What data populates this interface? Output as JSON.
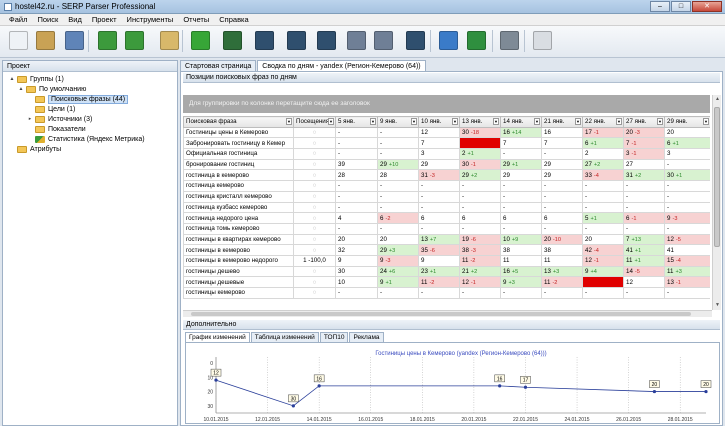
{
  "window": {
    "title": "hostel42.ru - SERP Parser Professional"
  },
  "menu": [
    "Файл",
    "Поиск",
    "Вид",
    "Проект",
    "Инструменты",
    "Отчеты",
    "Справка"
  ],
  "toolbar": {
    "buttons": [
      {
        "name": "new-project-icon",
        "color": "#eef2f6"
      },
      {
        "name": "open-folder-icon",
        "color": "#c9a255"
      },
      {
        "name": "settings-gear-icon",
        "color": "#5f84b8"
      },
      {
        "name": "play-icon",
        "color": "#3c9a3c"
      },
      {
        "name": "play-next-icon",
        "color": "#3c9a3c"
      },
      {
        "name": "edit-list-icon",
        "color": "#d8b86a"
      },
      {
        "name": "add-icon",
        "color": "#37a637"
      },
      {
        "name": "chart-icon",
        "color": "#2f6e3a"
      },
      {
        "name": "chart-line-icon",
        "color": "#2f4f6e"
      },
      {
        "name": "chart-up-icon",
        "color": "#2f4f6e"
      },
      {
        "name": "chart-circle-icon",
        "color": "#2f4f6e"
      },
      {
        "name": "calendar-chart-icon",
        "color": "#6f7f96"
      },
      {
        "name": "calendar-check-icon",
        "color": "#6f7f96"
      },
      {
        "name": "chart-area-icon",
        "color": "#2f4f6e"
      },
      {
        "name": "refresh-icon",
        "color": "#3a7bc8"
      },
      {
        "name": "excel-icon",
        "color": "#2f8f3f"
      },
      {
        "name": "sliders-icon",
        "color": "#7e8a96"
      },
      {
        "name": "home-icon",
        "color": "#d9dde2"
      }
    ]
  },
  "project_panel": {
    "header": "Проект",
    "tree": [
      {
        "label": "Группы (1)",
        "level": 0,
        "expander": "▲",
        "icon": "folder"
      },
      {
        "label": "По умолчанию",
        "level": 1,
        "expander": "▲",
        "icon": "folder"
      },
      {
        "label": "Поисковые фразы (44)",
        "level": 2,
        "expander": "",
        "icon": "folder",
        "selected": true
      },
      {
        "label": "Цели (1)",
        "level": 2,
        "expander": "",
        "icon": "folder"
      },
      {
        "label": "Источники (3)",
        "level": 2,
        "expander": "▸",
        "icon": "folder"
      },
      {
        "label": "Показатели",
        "level": 2,
        "expander": "",
        "icon": "folder"
      },
      {
        "label": "Статистика (Яндекс Метрика)",
        "level": 2,
        "expander": "",
        "icon": "stats"
      },
      {
        "label": "Атрибуты",
        "level": 0,
        "expander": "",
        "icon": "folder"
      }
    ]
  },
  "doc_tabs": [
    {
      "label": "Стартовая страница",
      "active": false
    },
    {
      "label": "Сводка по дням - yandex (Регион-Кемерово (64))",
      "active": true
    }
  ],
  "positions_section": {
    "header": "Позиции поисковых фраз по дням",
    "group_hint": "Для группировки по колонке перетащите сюда ее заголовок"
  },
  "grid": {
    "columns": [
      "Поисковая фраза",
      "Посещения",
      "5 янв.",
      "9 янв.",
      "10 янв.",
      "13 янв.",
      "14 янв.",
      "21 янв.",
      "22 янв.",
      "27 янв.",
      "29 янв."
    ],
    "rows": [
      {
        "phrase": "Гостиницы цены в Кемерово",
        "visits": "○",
        "cells": [
          [
            "-",
            ""
          ],
          [
            "-",
            ""
          ],
          [
            "12",
            ""
          ],
          [
            "30",
            "-18",
            "neg"
          ],
          [
            "16",
            "+14",
            "pos"
          ],
          [
            "16",
            ""
          ],
          [
            "17",
            "-1",
            "neg"
          ],
          [
            "20",
            "-3",
            "neg"
          ],
          [
            "20",
            ""
          ]
        ]
      },
      {
        "phrase": "Забронировать гостиницу в Кемер",
        "visits": "○",
        "cells": [
          [
            "-",
            ""
          ],
          [
            "-",
            ""
          ],
          [
            "7",
            ""
          ],
          [
            "",
            "",
            "hot"
          ],
          [
            "7",
            ""
          ],
          [
            "7",
            ""
          ],
          [
            "6",
            "+1",
            "pos"
          ],
          [
            "7",
            "-1",
            "neg"
          ],
          [
            "6",
            "+1",
            "pos"
          ]
        ]
      },
      {
        "phrase": "Официальная гостиница",
        "visits": "○",
        "cells": [
          [
            "-",
            ""
          ],
          [
            "-",
            ""
          ],
          [
            "3",
            ""
          ],
          [
            "2",
            "+1",
            "pos"
          ],
          [
            "-",
            ""
          ],
          [
            "-",
            ""
          ],
          [
            "2",
            ""
          ],
          [
            "3",
            "-1",
            "neg"
          ],
          [
            "3",
            ""
          ]
        ]
      },
      {
        "phrase": "бронирование гостиниц",
        "visits": "○",
        "cells": [
          [
            "39",
            ""
          ],
          [
            "29",
            "+10",
            "pos"
          ],
          [
            "29",
            ""
          ],
          [
            "30",
            "-1",
            "neg"
          ],
          [
            "29",
            "+1",
            "pos"
          ],
          [
            "29",
            ""
          ],
          [
            "27",
            "+2",
            "pos"
          ],
          [
            "27",
            ""
          ],
          [
            "-",
            ""
          ]
        ]
      },
      {
        "phrase": "гостиница в кемерово",
        "visits": "○",
        "cells": [
          [
            "28",
            ""
          ],
          [
            "28",
            ""
          ],
          [
            "31",
            "-3",
            "neg"
          ],
          [
            "29",
            "+2",
            "pos"
          ],
          [
            "29",
            ""
          ],
          [
            "29",
            ""
          ],
          [
            "33",
            "-4",
            "neg"
          ],
          [
            "31",
            "+2",
            "pos"
          ],
          [
            "30",
            "+1",
            "pos"
          ]
        ]
      },
      {
        "phrase": "гостиница кемерово",
        "visits": "○",
        "cells": [
          [
            "-",
            ""
          ],
          [
            "-",
            ""
          ],
          [
            "-",
            ""
          ],
          [
            "-",
            ""
          ],
          [
            "-",
            ""
          ],
          [
            "-",
            ""
          ],
          [
            "-",
            ""
          ],
          [
            "-",
            ""
          ],
          [
            "-",
            ""
          ]
        ]
      },
      {
        "phrase": "гостиница кристалл кемерово",
        "visits": "○",
        "cells": [
          [
            "-",
            ""
          ],
          [
            "-",
            ""
          ],
          [
            "-",
            ""
          ],
          [
            "-",
            ""
          ],
          [
            "-",
            ""
          ],
          [
            "-",
            ""
          ],
          [
            "-",
            ""
          ],
          [
            "-",
            ""
          ],
          [
            "-",
            ""
          ]
        ]
      },
      {
        "phrase": "гостиница кузбасс кемерово",
        "visits": "○",
        "cells": [
          [
            "-",
            ""
          ],
          [
            "-",
            ""
          ],
          [
            "-",
            ""
          ],
          [
            "-",
            ""
          ],
          [
            "-",
            ""
          ],
          [
            "-",
            ""
          ],
          [
            "-",
            ""
          ],
          [
            "-",
            ""
          ],
          [
            "-",
            ""
          ]
        ]
      },
      {
        "phrase": "гостиница недорого цена",
        "visits": "○",
        "cells": [
          [
            "4",
            ""
          ],
          [
            "6",
            "-2",
            "neg"
          ],
          [
            "6",
            ""
          ],
          [
            "6",
            ""
          ],
          [
            "6",
            ""
          ],
          [
            "6",
            ""
          ],
          [
            "5",
            "+1",
            "pos"
          ],
          [
            "6",
            "-1",
            "neg"
          ],
          [
            "9",
            "-3",
            "neg"
          ]
        ]
      },
      {
        "phrase": "гостиница томь кемерово",
        "visits": "○",
        "cells": [
          [
            "-",
            ""
          ],
          [
            "-",
            ""
          ],
          [
            "-",
            ""
          ],
          [
            "-",
            ""
          ],
          [
            "-",
            ""
          ],
          [
            "-",
            ""
          ],
          [
            "-",
            ""
          ],
          [
            "-",
            ""
          ],
          [
            "-",
            ""
          ]
        ]
      },
      {
        "phrase": "гостиницы в квартирах кемерово",
        "visits": "○",
        "cells": [
          [
            "20",
            ""
          ],
          [
            "20",
            ""
          ],
          [
            "13",
            "+7",
            "pos"
          ],
          [
            "19",
            "-6",
            "neg"
          ],
          [
            "10",
            "+9",
            "pos"
          ],
          [
            "20",
            "-10",
            "neg"
          ],
          [
            "20",
            ""
          ],
          [
            "7",
            "+13",
            "pos"
          ],
          [
            "12",
            "-5",
            "neg"
          ]
        ]
      },
      {
        "phrase": "гостиницы в кемерово",
        "visits": "○",
        "cells": [
          [
            "32",
            ""
          ],
          [
            "29",
            "+3",
            "pos"
          ],
          [
            "35",
            "-6",
            "neg"
          ],
          [
            "38",
            "-3",
            "neg"
          ],
          [
            "38",
            ""
          ],
          [
            "38",
            ""
          ],
          [
            "42",
            "-4",
            "neg"
          ],
          [
            "41",
            "+1",
            "pos"
          ],
          [
            "41",
            ""
          ]
        ]
      },
      {
        "phrase": "гостиницы в кемерово недорого",
        "visits": "1 -100,0",
        "cells": [
          [
            "9",
            ""
          ],
          [
            "9",
            "-3",
            "neg"
          ],
          [
            "9",
            ""
          ],
          [
            "11",
            "-2",
            "neg"
          ],
          [
            "11",
            ""
          ],
          [
            "11",
            ""
          ],
          [
            "12",
            "-1",
            "neg"
          ],
          [
            "11",
            "+1",
            "pos"
          ],
          [
            "15",
            "-4",
            "neg"
          ]
        ]
      },
      {
        "phrase": "гостиницы дешево",
        "visits": "○",
        "cells": [
          [
            "30",
            ""
          ],
          [
            "24",
            "+6",
            "pos"
          ],
          [
            "23",
            "+1",
            "pos"
          ],
          [
            "21",
            "+2",
            "pos"
          ],
          [
            "16",
            "+5",
            "pos"
          ],
          [
            "13",
            "+3",
            "pos"
          ],
          [
            "9",
            "+4",
            "pos"
          ],
          [
            "14",
            "-5",
            "neg"
          ],
          [
            "11",
            "+3",
            "pos"
          ]
        ]
      },
      {
        "phrase": "гостиницы дешевые",
        "visits": "○",
        "cells": [
          [
            "10",
            ""
          ],
          [
            "9",
            "+1",
            "pos"
          ],
          [
            "11",
            "-2",
            "neg"
          ],
          [
            "12",
            "-1",
            "neg"
          ],
          [
            "9",
            "+3",
            "pos"
          ],
          [
            "11",
            "-2",
            "neg"
          ],
          [
            "",
            "",
            "hot"
          ],
          [
            "12",
            ""
          ],
          [
            "13",
            "-1",
            "neg"
          ]
        ]
      },
      {
        "phrase": "гостиницы кемерово",
        "visits": "○",
        "cells": [
          [
            "-",
            ""
          ],
          [
            "-",
            ""
          ],
          [
            "-",
            ""
          ],
          [
            "-",
            ""
          ],
          [
            "-",
            ""
          ],
          [
            "-",
            ""
          ],
          [
            "-",
            ""
          ],
          [
            "-",
            ""
          ],
          [
            "-",
            ""
          ]
        ]
      }
    ]
  },
  "extra_section": {
    "header": "Дополнительно"
  },
  "lower_tabs": [
    {
      "label": "График изменений",
      "active": true
    },
    {
      "label": "Таблица изменений",
      "active": false
    },
    {
      "label": "ТОП10",
      "active": false
    },
    {
      "label": "Реклама",
      "active": false
    }
  ],
  "chart_data": {
    "type": "line",
    "title": "Гостиницы цены в Кемерово (yandex (Регион-Кемерово (64)))",
    "x_ticks": [
      "10.01.2015",
      "12.01.2015",
      "14.01.2015",
      "16.01.2015",
      "18.01.2015",
      "20.01.2015",
      "22.01.2015",
      "24.01.2015",
      "26.01.2015",
      "28.01.2015"
    ],
    "y_ticks": [
      0,
      10,
      20,
      30
    ],
    "ylim": [
      0,
      35
    ],
    "x_range_days": [
      10,
      29
    ],
    "inverted_y": true,
    "points": [
      {
        "day": 10,
        "value": 12,
        "label": "12"
      },
      {
        "day": 13,
        "value": 30,
        "label": "30"
      },
      {
        "day": 14,
        "value": 16,
        "label": "16"
      },
      {
        "day": 21,
        "value": 16,
        "label": "16"
      },
      {
        "day": 22,
        "value": 17,
        "label": "17"
      },
      {
        "day": 27,
        "value": 20,
        "label": "20"
      },
      {
        "day": 29,
        "value": 20,
        "label": "20"
      }
    ],
    "line_color": "#2a3f9a"
  }
}
